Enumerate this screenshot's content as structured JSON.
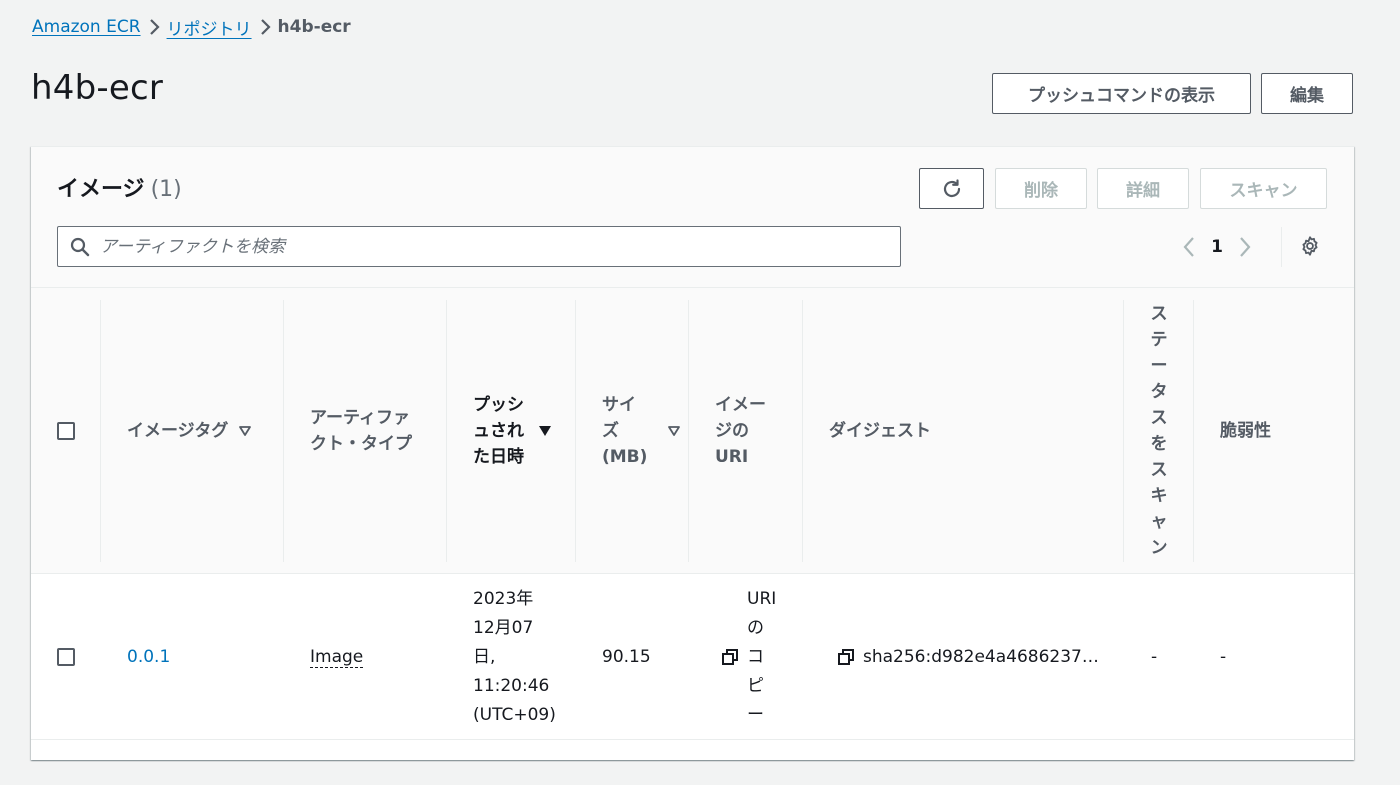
{
  "breadcrumb": {
    "items": [
      "Amazon ECR",
      "リポジトリ"
    ],
    "current": "h4b-ecr"
  },
  "page": {
    "title": "h4b-ecr",
    "push_button": "プッシュコマンドの表示",
    "edit_button": "編集"
  },
  "panel": {
    "title": "イメージ",
    "count": "(1)",
    "buttons": {
      "delete": "削除",
      "details": "詳細",
      "scan": "スキャン"
    },
    "search_placeholder": "アーティファクトを検索",
    "pagination": {
      "current_page": "1"
    }
  },
  "table": {
    "columns": {
      "tag": "イメージタグ",
      "artifact_type_1": "アーティファ",
      "artifact_type_2": "クト・タイプ",
      "pushed_1": "プッシ",
      "pushed_2": "ュされ",
      "pushed_3": "た日時",
      "size_1": "サイ",
      "size_2": "ズ",
      "size_3": "(MB)",
      "uri_1": "イメー",
      "uri_2": "ジの",
      "uri_3": "URI",
      "digest": "ダイジェスト",
      "scan_status_chars": [
        "ス",
        "テ",
        "ー",
        "タ",
        "ス",
        "を",
        "ス",
        "キ",
        "ャ",
        "ン"
      ],
      "vulnerability": "脆弱性"
    },
    "rows": [
      {
        "tag": "0.0.1",
        "artifact_type": "Image",
        "pushed_lines": [
          "2023年",
          "12月07",
          "日,",
          "11:20:46",
          "(UTC+09)"
        ],
        "size": "90.15",
        "uri_copy_chars": [
          "URI",
          "の",
          "コ",
          "ピ",
          "ー"
        ],
        "digest": "sha256:d982e4a4686237…",
        "scan_status": "-",
        "vulnerability": "-"
      }
    ]
  }
}
